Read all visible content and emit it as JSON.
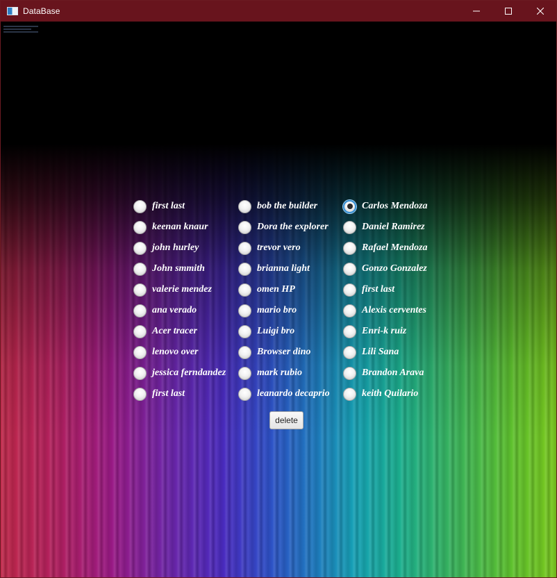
{
  "window": {
    "title": "DataBase",
    "controls": [
      "minimize-icon",
      "maximize-icon",
      "close-icon"
    ],
    "titlebar_color": "#68141d"
  },
  "columns": [
    {
      "items": [
        {
          "label": "first last",
          "selected": false
        },
        {
          "label": "keenan knaur",
          "selected": false
        },
        {
          "label": "john hurley",
          "selected": false
        },
        {
          "label": "John smmith",
          "selected": false
        },
        {
          "label": "valerie mendez",
          "selected": false
        },
        {
          "label": "ana verado",
          "selected": false
        },
        {
          "label": "Acer tracer",
          "selected": false
        },
        {
          "label": "lenovo over",
          "selected": false
        },
        {
          "label": "jessica ferndandez",
          "selected": false
        },
        {
          "label": "first last",
          "selected": false
        }
      ]
    },
    {
      "items": [
        {
          "label": "bob the builder",
          "selected": false
        },
        {
          "label": "Dora the explorer",
          "selected": false
        },
        {
          "label": "trevor vero",
          "selected": false
        },
        {
          "label": "brianna light",
          "selected": false
        },
        {
          "label": "omen HP",
          "selected": false
        },
        {
          "label": "mario bro",
          "selected": false
        },
        {
          "label": "Luigi bro",
          "selected": false
        },
        {
          "label": "Browser dino",
          "selected": false
        },
        {
          "label": "mark rubio",
          "selected": false
        },
        {
          "label": "leanardo decaprio",
          "selected": false
        }
      ]
    },
    {
      "items": [
        {
          "label": "Carlos Mendoza",
          "selected": true
        },
        {
          "label": "Daniel Ramirez",
          "selected": false
        },
        {
          "label": "Rafael Mendoza",
          "selected": false
        },
        {
          "label": "Gonzo Gonzalez",
          "selected": false
        },
        {
          "label": "first last",
          "selected": false
        },
        {
          "label": "Alexis cerventes",
          "selected": false
        },
        {
          "label": "Enri-k ruiz",
          "selected": false
        },
        {
          "label": "Lili Sana",
          "selected": false
        },
        {
          "label": "Brandon Arava",
          "selected": false
        },
        {
          "label": "keith Quilario",
          "selected": false
        }
      ]
    }
  ],
  "actions": {
    "delete_label": "delete"
  }
}
